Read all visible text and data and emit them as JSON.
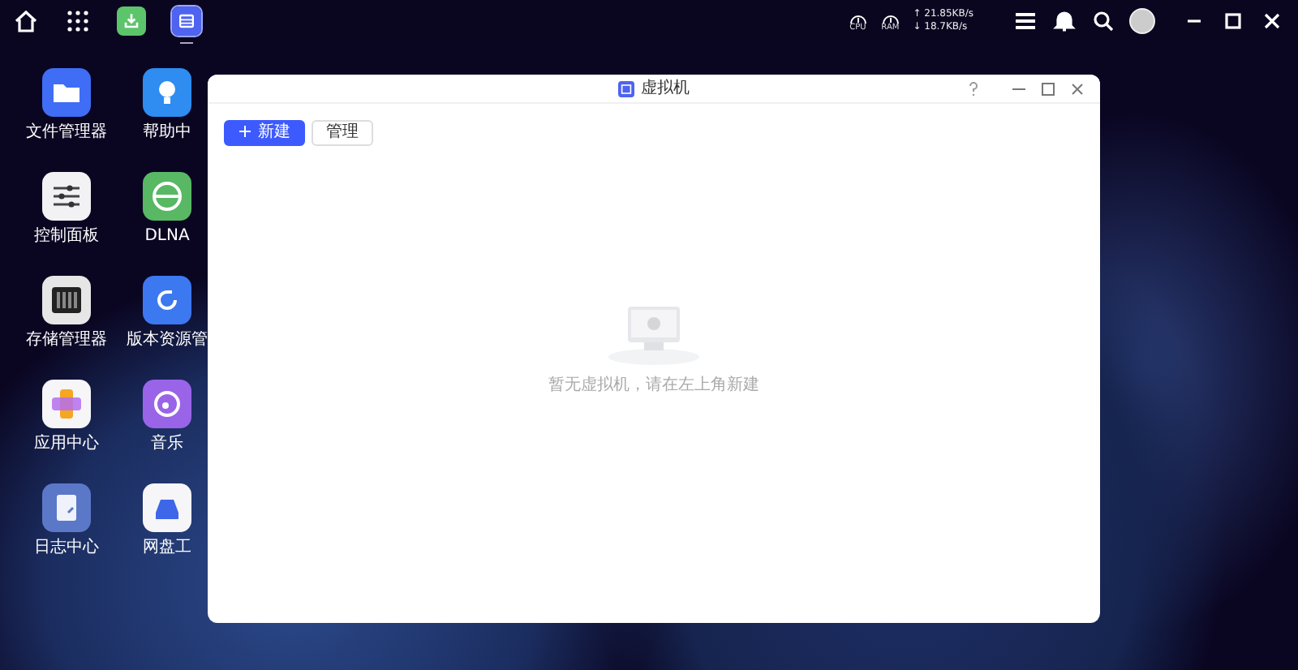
{
  "taskbar": {
    "apps": [
      {
        "kind": "download",
        "selected": false
      },
      {
        "kind": "vm",
        "selected": true
      }
    ],
    "monitors": [
      {
        "label": "CPU"
      },
      {
        "label": "RAM"
      }
    ],
    "upload": "↑ 21.85KB/s",
    "download": "↓ 18.7KB/s"
  },
  "desktop": {
    "icons": [
      {
        "label": "文件管理器",
        "kind": "folder"
      },
      {
        "label": "控制面板",
        "kind": "sliders"
      },
      {
        "label": "存储管理器",
        "kind": "storage"
      },
      {
        "label": "应用中心",
        "kind": "apps"
      },
      {
        "label": "日志中心",
        "kind": "log"
      },
      {
        "label": "帮助中",
        "kind": "help"
      },
      {
        "label": "DLNA",
        "kind": "dlna"
      },
      {
        "label": "版本资源管",
        "kind": "version"
      },
      {
        "label": "音乐",
        "kind": "music"
      },
      {
        "label": "网盘工",
        "kind": "cloud"
      }
    ]
  },
  "window": {
    "title": "虚拟机",
    "toolbar": [
      {
        "label": "新建",
        "kind": "primary"
      },
      {
        "label": "管理",
        "kind": "default"
      }
    ],
    "empty_message": "暂无虚拟机，请在左上角新建"
  }
}
